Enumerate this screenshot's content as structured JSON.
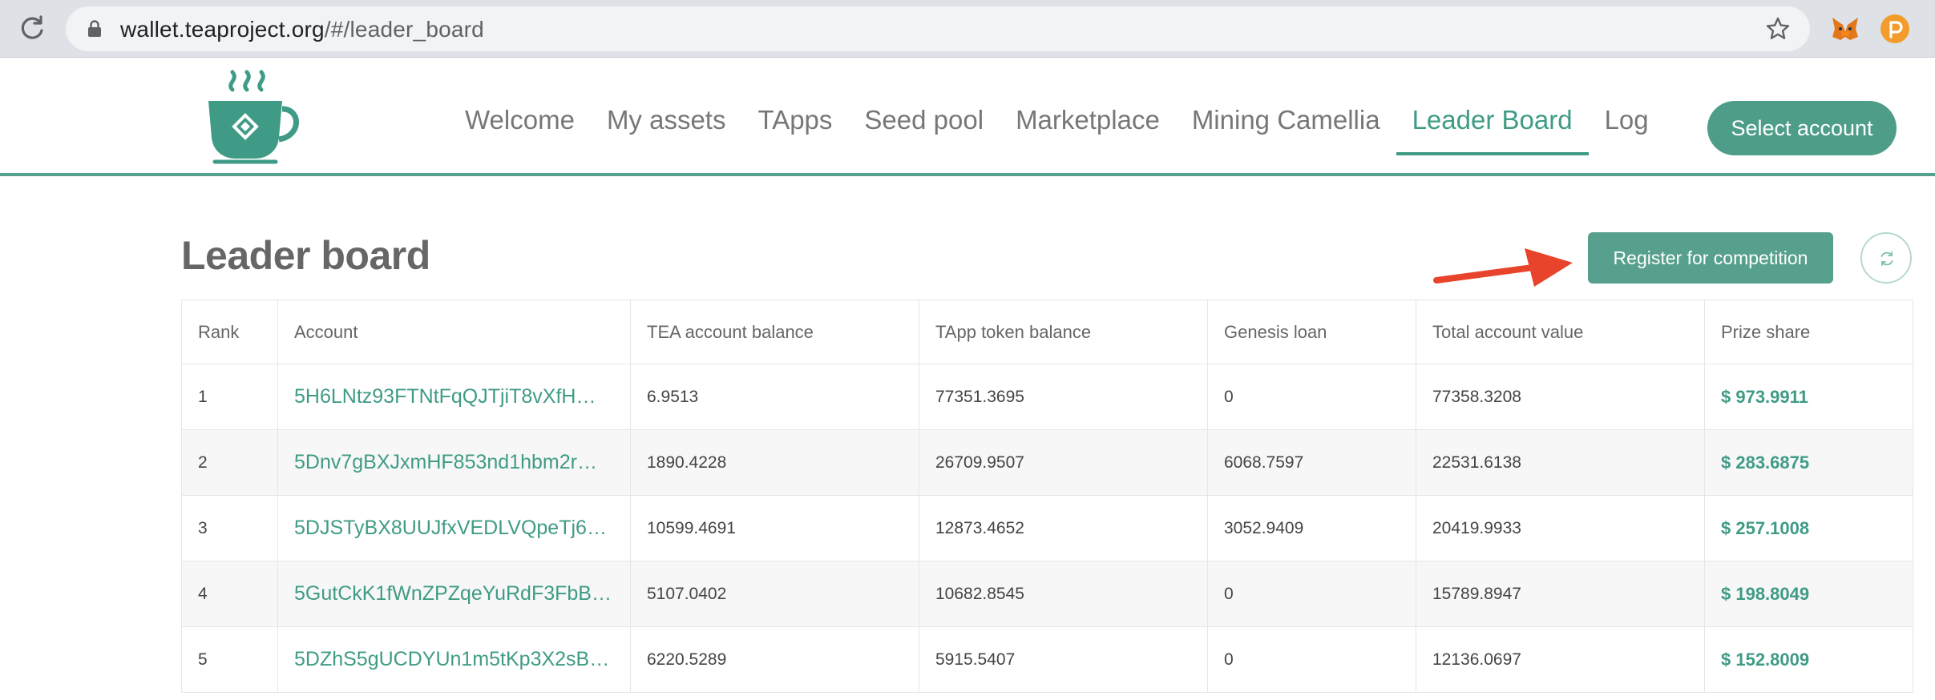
{
  "browser": {
    "url_host": "wallet.teaproject.org",
    "url_path": "/#/leader_board"
  },
  "nav": {
    "items": [
      {
        "label": "Welcome",
        "active": false
      },
      {
        "label": "My assets",
        "active": false
      },
      {
        "label": "TApps",
        "active": false
      },
      {
        "label": "Seed pool",
        "active": false
      },
      {
        "label": "Marketplace",
        "active": false
      },
      {
        "label": "Mining Camellia",
        "active": false
      },
      {
        "label": "Leader Board",
        "active": true
      },
      {
        "label": "Log",
        "active": false
      }
    ],
    "select_account_label": "Select account"
  },
  "main": {
    "title": "Leader board",
    "register_label": "Register for competition"
  },
  "table": {
    "headers": [
      "Rank",
      "Account",
      "TEA account balance",
      "TApp token balance",
      "Genesis loan",
      "Total account value",
      "Prize share"
    ],
    "rows": [
      {
        "rank": "1",
        "account": "5H6LNtz93FTNtFqQJTjiT8vXfH…",
        "tea_balance": "6.9513",
        "tapp_balance": "77351.3695",
        "genesis_loan": "0",
        "total_value": "77358.3208",
        "prize": "$ 973.9911"
      },
      {
        "rank": "2",
        "account": "5Dnv7gBXJxmHF853nd1hbm2r…",
        "tea_balance": "1890.4228",
        "tapp_balance": "26709.9507",
        "genesis_loan": "6068.7597",
        "total_value": "22531.6138",
        "prize": "$ 283.6875"
      },
      {
        "rank": "3",
        "account": "5DJSTyBX8UUJfxVEDLVQpeTj66…",
        "tea_balance": "10599.4691",
        "tapp_balance": "12873.4652",
        "genesis_loan": "3052.9409",
        "total_value": "20419.9933",
        "prize": "$ 257.1008"
      },
      {
        "rank": "4",
        "account": "5GutCkK1fWnZPZqeYuRdF3FbB…",
        "tea_balance": "5107.0402",
        "tapp_balance": "10682.8545",
        "genesis_loan": "0",
        "total_value": "15789.8947",
        "prize": "$ 198.8049"
      },
      {
        "rank": "5",
        "account": "5DZhS5gUCDYUn1m5tKp3X2sB…",
        "tea_balance": "6220.5289",
        "tapp_balance": "5915.5407",
        "genesis_loan": "0",
        "total_value": "12136.0697",
        "prize": "$ 152.8009"
      }
    ]
  },
  "colors": {
    "brand": "#57a08d",
    "link": "#3f9b86",
    "arrow": "#e8442b"
  },
  "icons": [
    "reload-icon",
    "lock-icon",
    "star-icon",
    "metamask-icon",
    "polkadot-icon",
    "tea-cup-logo",
    "refresh-icon",
    "arrow-annotation"
  ]
}
